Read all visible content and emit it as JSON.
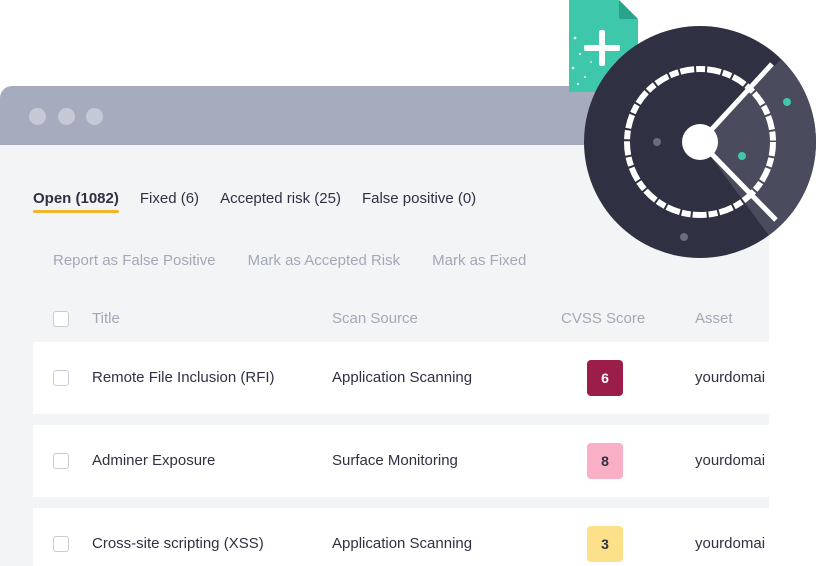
{
  "tabs": [
    {
      "label": "Open (1082)",
      "active": true
    },
    {
      "label": "Fixed (6)",
      "active": false
    },
    {
      "label": "Accepted risk (25)",
      "active": false
    },
    {
      "label": "False positive (0)",
      "active": false
    }
  ],
  "actions": {
    "false_positive": "Report as False Positive",
    "accepted_risk": "Mark as Accepted Risk",
    "fixed": "Mark as Fixed"
  },
  "columns": {
    "title": "Title",
    "scan_source": "Scan Source",
    "cvss": "CVSS Score",
    "asset": "Asset"
  },
  "rows": [
    {
      "title": "Remote File Inclusion (RFI)",
      "source": "Application Scanning",
      "score": "6",
      "score_bg": "#9b1d4a",
      "score_color": "#ffffff",
      "asset": "yourdomai"
    },
    {
      "title": "Adminer Exposure",
      "source": "Surface Monitoring",
      "score": "8",
      "score_bg": "#f9afc6",
      "score_color": "#2f3143",
      "asset": "yourdomai"
    },
    {
      "title": "Cross-site scripting (XSS)",
      "source": "Application Scanning",
      "score": "3",
      "score_bg": "#fde08a",
      "score_color": "#2f3143",
      "asset": "yourdomai"
    }
  ],
  "colors": {
    "accent": "#f2b62c",
    "teal": "#3ec7ab",
    "radar_dark": "#2f3143",
    "radar_mid": "#4a4c5d"
  },
  "icons": [
    "window-dot-icon",
    "checkbox-icon",
    "add-document-icon",
    "radar-scan-icon"
  ]
}
